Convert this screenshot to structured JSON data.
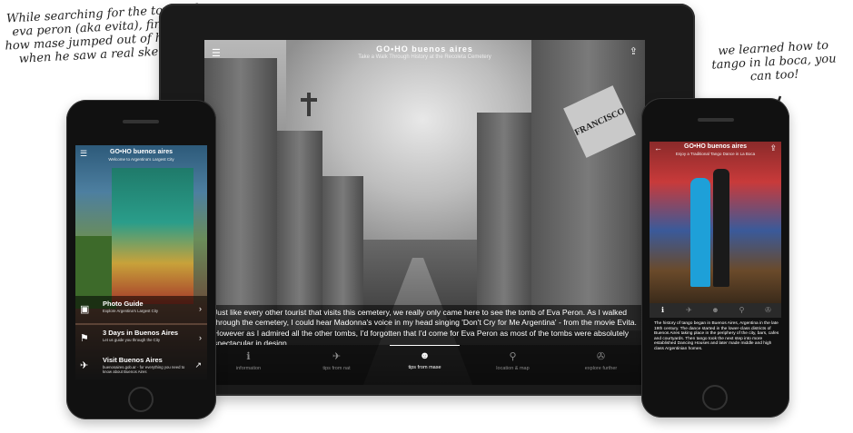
{
  "annotations": {
    "left_note": "While searching for the tomb of eva peron (aka evita), find out how mase jumped out of his skin when he saw a real skeleton",
    "right_note": "we learned how to tango in la boca, you can too!"
  },
  "tablet": {
    "logo": "GO•HO buenos aires",
    "subtitle": "Take a Walk Through History at the Recoleta Cemetery",
    "text": "Just like every other tourist that visits this cemetery, we really only came here to see the tomb of Eva Peron. As I walked through the cemetery, I could hear Madonna's voice in my head singing 'Don't Cry for Me Argentina' - from the movie Evita. However as I admired all the other tombs, I'd forgotten that I'd come for Eva Peron as most of the tombs were absolutely spectacular in design",
    "nav": [
      {
        "icon": "info-icon",
        "glyph": "ℹ",
        "label": "information",
        "active": false
      },
      {
        "icon": "tips-icon",
        "glyph": "✈",
        "label": "tips from nat",
        "active": false
      },
      {
        "icon": "mase-icon",
        "glyph": "☻",
        "label": "tips from mase",
        "active": true
      },
      {
        "icon": "map-pin-icon",
        "glyph": "⚲",
        "label": "location & map",
        "active": false
      },
      {
        "icon": "explore-icon",
        "glyph": "✇",
        "label": "explore further",
        "active": false
      }
    ],
    "sign_text": "FRANCISCO"
  },
  "phone_left": {
    "logo": "GO•HO buenos aires",
    "subtitle": "Welcome to Argentina's Largest City",
    "items": [
      {
        "title": "Photo Guide",
        "sub": "Explore Argentina's Largest City",
        "glyph": "▣"
      },
      {
        "title": "3 Days in Buenos Aires",
        "sub": "Let us guide you through the City",
        "glyph": "⚑"
      },
      {
        "title": "Visit Buenos Aires",
        "sub": "buenosaires.gob.ar - for everything you need to know about Buenos Aires",
        "glyph": "✈"
      }
    ]
  },
  "phone_right": {
    "logo": "GO•HO buenos aires",
    "subtitle": "Enjoy a Traditional Tango Dance in La Boca",
    "text": "The history of tango began in Buenos Aires, Argentina in the late 19th century. The dance started in the lower-class districts of Buenos Aires taking place in the periphery of the city, bars, cafes and courtyards. Then tango took the next step into more established Dancing Houses and later made middle and high class Argentinian homes.",
    "nav": [
      {
        "icon": "info-icon",
        "glyph": "ℹ",
        "active": true
      },
      {
        "icon": "walk-icon",
        "glyph": "✈",
        "active": false
      },
      {
        "icon": "mase-icon",
        "glyph": "☻",
        "active": false
      },
      {
        "icon": "map-pin-icon",
        "glyph": "⚲",
        "active": false
      },
      {
        "icon": "explore-icon",
        "glyph": "✇",
        "active": false
      }
    ]
  }
}
